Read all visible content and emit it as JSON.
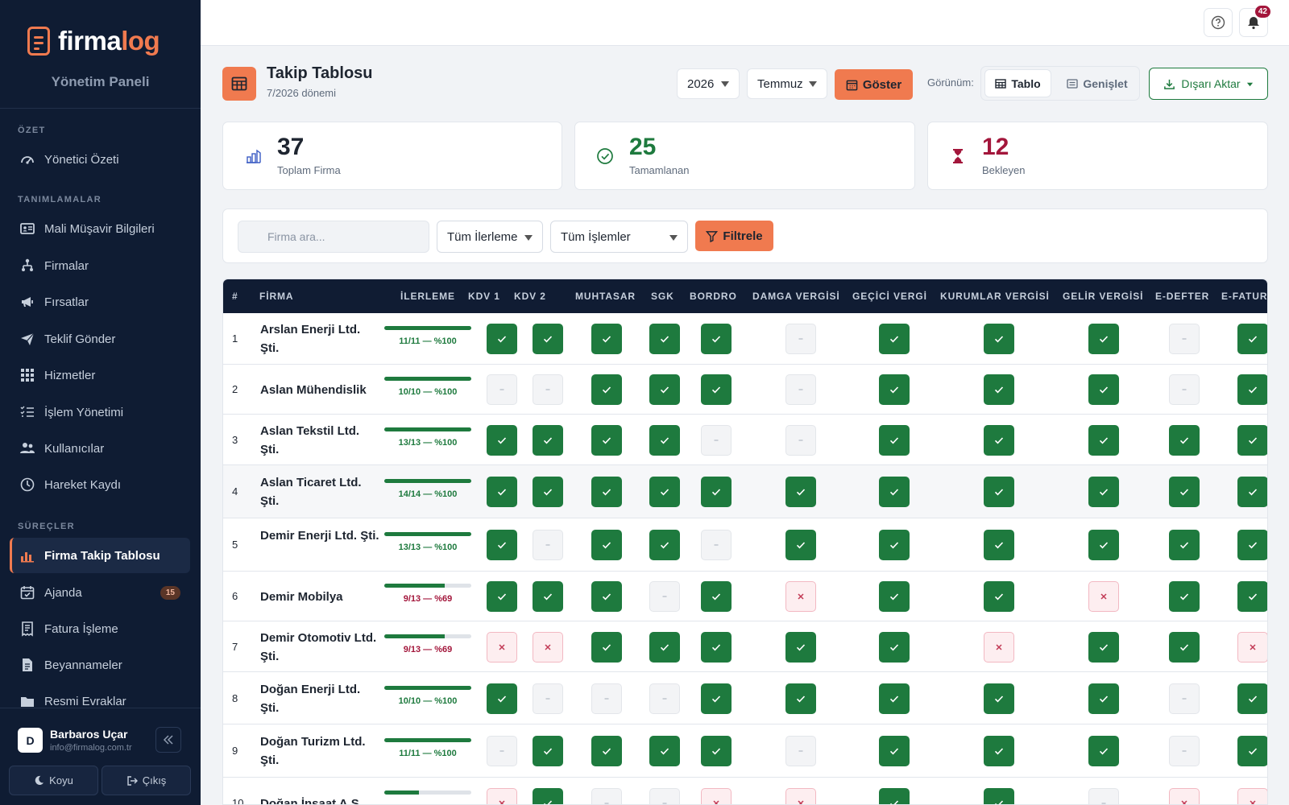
{
  "brand": {
    "name_a": "firma",
    "name_b": "log",
    "panel": "Yönetim Paneli"
  },
  "sidebar": {
    "sections": [
      "ÖZET",
      "TANIMLAMALAR",
      "SÜREÇLER"
    ],
    "items": [
      {
        "label": "Yönetici Özeti",
        "icon": "dashboard-gauge-icon"
      },
      {
        "label": "Mali Müşavir Bilgileri",
        "icon": "id-card-icon"
      },
      {
        "label": "Firmalar",
        "icon": "sitemap-icon"
      },
      {
        "label": "Fırsatlar",
        "icon": "megaphone-icon"
      },
      {
        "label": "Teklif Gönder",
        "icon": "paper-plane-icon"
      },
      {
        "label": "Hizmetler",
        "icon": "grid-icon"
      },
      {
        "label": "İşlem Yönetimi",
        "icon": "list-check-icon"
      },
      {
        "label": "Kullanıcılar",
        "icon": "users-icon"
      },
      {
        "label": "Hareket Kaydı",
        "icon": "clock-history-icon"
      },
      {
        "label": "Firma Takip Tablosu",
        "icon": "bar-chart-icon"
      },
      {
        "label": "Ajanda",
        "icon": "calendar-check-icon",
        "badge": "15"
      },
      {
        "label": "Fatura İşleme",
        "icon": "receipt-icon"
      },
      {
        "label": "Beyannameler",
        "icon": "document-icon"
      },
      {
        "label": "Resmi Evraklar",
        "icon": "folder-icon"
      }
    ],
    "user": {
      "initial": "D",
      "name": "Barbaros Uçar",
      "email": "info@firmalog.com.tr"
    },
    "footer": {
      "theme": "Koyu",
      "logout": "Çıkış"
    }
  },
  "topbar": {
    "notif_count": "42"
  },
  "header": {
    "title": "Takip Tablosu",
    "subtitle": "7/2026 dönemi",
    "year": "2026",
    "month": "Temmuz",
    "show": "Göster",
    "view_label": "Görünüm:",
    "view_table": "Tablo",
    "view_expand": "Genişlet",
    "export": "Dışarı Aktar"
  },
  "stats": [
    {
      "value": "37",
      "label": "Toplam Firma",
      "color": "#1e2530"
    },
    {
      "value": "25",
      "label": "Tamamlanan",
      "color": "#1e7a3e"
    },
    {
      "value": "12",
      "label": "Bekleyen",
      "color": "#a3163b"
    }
  ],
  "filters": {
    "search_placeholder": "Firma ara...",
    "progress": "Tüm İlerleme",
    "ops": "Tüm İşlemler",
    "apply": "Filtrele"
  },
  "table": {
    "columns": [
      "#",
      "FİRMA",
      "İLERLEME",
      "KDV 1",
      "KDV 2",
      "MUHTASAR",
      "SGK",
      "BORDRO",
      "DAMGA VERGİSİ",
      "GEÇİCİ VERGİ",
      "KURUMLAR VERGİSİ",
      "GELİR VERGİSİ",
      "E-DEFTER",
      "E-FATUR"
    ],
    "rows": [
      {
        "no": "1",
        "name": "Arslan Enerji Ltd. Şti.",
        "progress": "11/11 — %100",
        "pct": 100,
        "cells": [
          "ok",
          "ok",
          "ok",
          "ok",
          "ok",
          "na",
          "ok",
          "ok",
          "ok",
          "na",
          "ok"
        ]
      },
      {
        "no": "2",
        "name": "Aslan Mühendislik",
        "progress": "10/10 — %100",
        "pct": 100,
        "cells": [
          "na",
          "na",
          "ok",
          "ok",
          "ok",
          "na",
          "ok",
          "ok",
          "ok",
          "na",
          "ok"
        ]
      },
      {
        "no": "3",
        "name": "Aslan Tekstil Ltd. Şti.",
        "progress": "13/13 — %100",
        "pct": 100,
        "cells": [
          "ok",
          "ok",
          "ok",
          "ok",
          "na",
          "na",
          "ok",
          "ok",
          "ok",
          "ok",
          "ok"
        ]
      },
      {
        "no": "4",
        "name": "Aslan Ticaret Ltd. Şti.",
        "progress": "14/14 — %100",
        "pct": 100,
        "cells": [
          "ok",
          "ok",
          "ok",
          "ok",
          "ok",
          "ok",
          "ok",
          "ok",
          "ok",
          "ok",
          "ok"
        ]
      },
      {
        "no": "5",
        "name": "Demir Enerji Ltd. Şti.",
        "progress": "13/13 — %100",
        "pct": 100,
        "cells": [
          "ok",
          "na",
          "ok",
          "ok",
          "na",
          "ok",
          "ok",
          "ok",
          "ok",
          "ok",
          "ok"
        ]
      },
      {
        "no": "6",
        "name": "Demir Mobilya",
        "progress": "9/13 — %69",
        "pct": 69,
        "cells": [
          "ok",
          "ok",
          "ok",
          "na",
          "ok",
          "no",
          "ok",
          "ok",
          "no",
          "ok",
          "ok"
        ]
      },
      {
        "no": "7",
        "name": "Demir Otomotiv Ltd. Şti.",
        "progress": "9/13 — %69",
        "pct": 69,
        "cells": [
          "no",
          "no",
          "ok",
          "ok",
          "ok",
          "ok",
          "ok",
          "no",
          "ok",
          "ok",
          "no"
        ]
      },
      {
        "no": "8",
        "name": "Doğan Enerji Ltd. Şti.",
        "progress": "10/10 — %100",
        "pct": 100,
        "cells": [
          "ok",
          "na",
          "na",
          "na",
          "ok",
          "ok",
          "ok",
          "ok",
          "ok",
          "na",
          "ok"
        ]
      },
      {
        "no": "9",
        "name": "Doğan Turizm Ltd. Şti.",
        "progress": "11/11 — %100",
        "pct": 100,
        "cells": [
          "na",
          "ok",
          "ok",
          "ok",
          "ok",
          "na",
          "ok",
          "ok",
          "ok",
          "na",
          "ok"
        ]
      },
      {
        "no": "10",
        "name": "Doğan İnşaat A.Ş.",
        "progress": "",
        "pct": 40,
        "cells": [
          "no",
          "ok",
          "na",
          "na",
          "no",
          "no",
          "ok",
          "ok",
          "na",
          "no",
          "no"
        ]
      }
    ]
  },
  "colors": {
    "accent": "#f07a4f",
    "sidebar": "#0f1c33",
    "success": "#1e7a3e",
    "danger": "#a3163b"
  }
}
